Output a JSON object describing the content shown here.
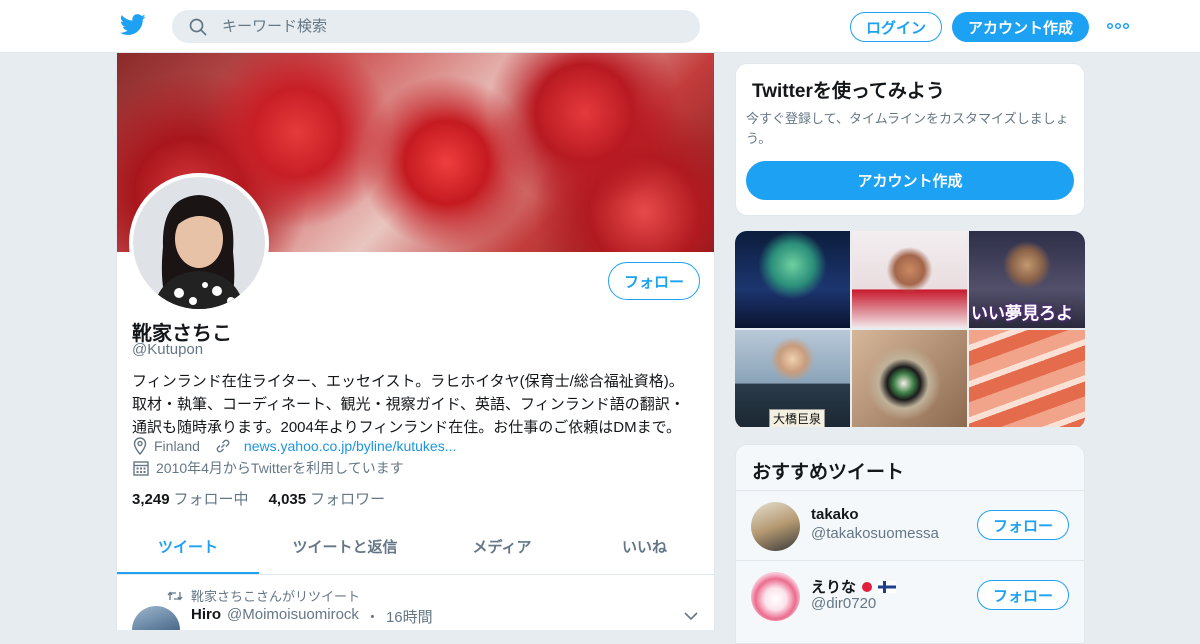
{
  "header": {
    "search_placeholder": "キーワード検索",
    "login_label": "ログイン",
    "signup_label": "アカウント作成"
  },
  "profile": {
    "name": "靴家さちこ",
    "handle": "@Kutupon",
    "follow_label": "フォロー",
    "bio_lines": [
      "フィンランド在住ライター、エッセイスト。ラヒホイタヤ(保育士/総合福祉資格)。",
      "取材・執筆、コーディネート、観光・視察ガイド、英語、フィンランド語の翻訳・",
      "通訳も随時承ります。2004年よりフィンランド在住。お仕事のご依頼はDMまで。"
    ],
    "location": "Finland",
    "link": "news.yahoo.co.jp/byline/kutukes...",
    "joined": "2010年4月からTwitterを利用しています",
    "following_count": "3,249",
    "following_label": "フォロー中",
    "followers_count": "4,035",
    "followers_label": "フォロワー"
  },
  "tabs": [
    {
      "label": "ツイート",
      "active": true
    },
    {
      "label": "ツイートと返信",
      "active": false
    },
    {
      "label": "メディア",
      "active": false
    },
    {
      "label": "いいね",
      "active": false
    }
  ],
  "tweet": {
    "retweet_note": "靴家さちこさんがリツイート",
    "author_name": "Hiro",
    "author_handle": "@Moimoisuomirock",
    "separator": "・",
    "time": "16時間"
  },
  "try_card": {
    "title": "Twitterを使ってみよう",
    "subtitle": "今すぐ登録して、タイムラインをカスタマイズしましょう。",
    "button_label": "アカウント作成"
  },
  "media": {
    "m3_text": "いい夢見ろよ",
    "m4_caption": "大橋巨泉"
  },
  "recommendations": {
    "title": "おすすめツイート",
    "items": [
      {
        "name": "takako",
        "handle": "@takakosuomessa",
        "follow_label": "フォロー"
      },
      {
        "name": "えりな",
        "handle": "@dir0720",
        "follow_label": "フォロー"
      }
    ]
  },
  "colors": {
    "accent": "#1da1f2",
    "muted": "#657786",
    "background": "#e6ecf0"
  }
}
